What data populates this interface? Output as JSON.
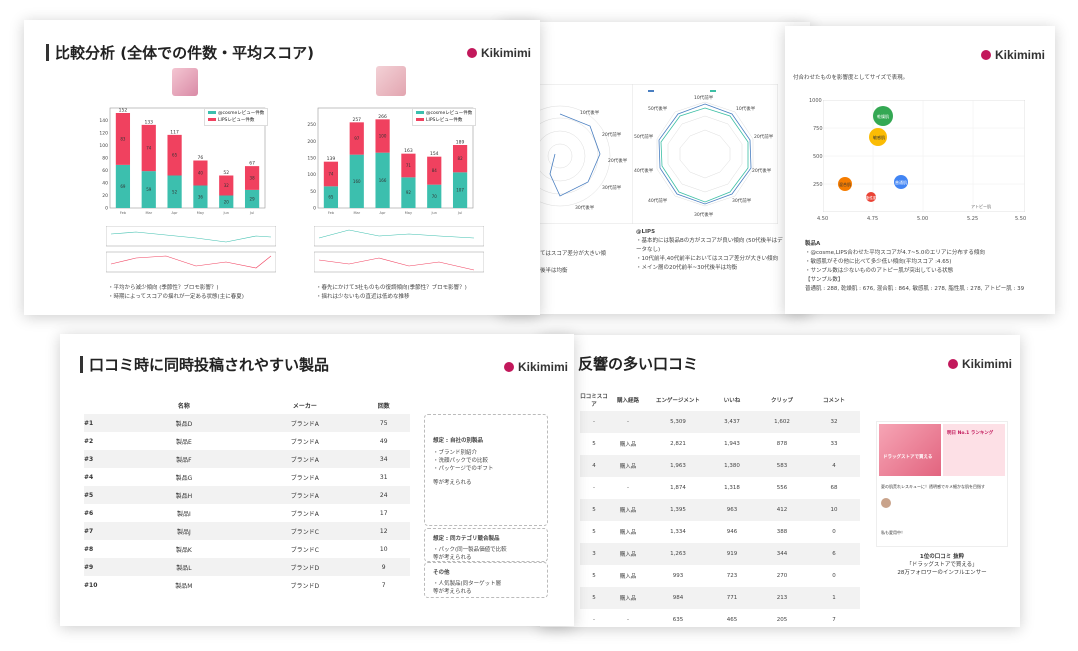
{
  "brand": "Kikimimi",
  "slide1": {
    "title": "比較分析 (全体での件数・平均スコア)",
    "legend": [
      "@cosmeレビュー件数",
      "LIPSレビュー件数"
    ],
    "left_notes": [
      "・平均から減少傾向 (季節性？ブロモ影響？)",
      "・時期によってスコアの揺れが一定ある状態(主に春夏)"
    ],
    "right_notes": [
      "・春先にかけて3社ものもの復調傾向(季節性？ブロモ影響？)",
      "・揺れは少ないもの直近は低めな推移"
    ]
  },
  "slide2": {
    "labels": [
      "10代前半",
      "10代後半",
      "20代前半",
      "20代後半",
      "30代前半",
      "30代後半",
      "40代前半",
      "40代後半",
      "50代前半",
      "50代後半"
    ],
    "left_notes": [
      "てはスコア差分が大きい傾",
      "後半は均衡"
    ],
    "right_head": "@LIPS",
    "right_notes": [
      "・基本的には製品Bの方がスコアが良い傾向 (50代後半はデータなし)",
      "・10代前半,40代前半においてはスコア差分が大きい傾向",
      "・メイン層の20代前半~30代後半は均衡"
    ]
  },
  "slide3": {
    "subtitle": "付合わせたものを影響度としてサイズで表現。",
    "yticks": [
      "1000",
      "750",
      "500",
      "250"
    ],
    "xticks": [
      "4.50",
      "4.75",
      "5.00",
      "5.25",
      "5.50"
    ],
    "bubbles": [
      "乾燥肌",
      "敏感肌",
      "混合肌",
      "普通肌",
      "脂性肌"
    ],
    "xaxis_label": "アトピー肌",
    "head": "製品A",
    "notes": [
      "・@cosme,LIPS合わせた平均スコアが4.7~5.0のエリアに分布する傾向",
      "・敏感肌がその他に比べて多少低い傾向(平均スコア :4.65)",
      "・サンプル数は少ないもののアトピー肌が突出している状態",
      "【サンプル数】",
      "普通肌 : 288, 乾燥肌 : 676, 混合肌 : 864, 敏感肌 : 278, 脂性肌 : 278, アトピー肌 : 39"
    ]
  },
  "slide4": {
    "title": "口コミ時に同時投稿されやすい製品",
    "headers": [
      "名称",
      "メーカー",
      "回数"
    ],
    "rows": [
      [
        "#1",
        "製品D",
        "ブランドA",
        "75"
      ],
      [
        "#2",
        "製品E",
        "ブランドA",
        "49"
      ],
      [
        "#3",
        "製品F",
        "ブランドA",
        "34"
      ],
      [
        "#4",
        "製品G",
        "ブランドA",
        "31"
      ],
      [
        "#5",
        "製品H",
        "ブランドA",
        "24"
      ],
      [
        "#6",
        "製品I",
        "ブランドA",
        "17"
      ],
      [
        "#7",
        "製品J",
        "ブランドC",
        "12"
      ],
      [
        "#8",
        "製品K",
        "ブランドC",
        "10"
      ],
      [
        "#9",
        "製品L",
        "ブランドD",
        "9"
      ],
      [
        "#10",
        "製品M",
        "ブランドD",
        "7"
      ]
    ],
    "box1_head": "想定 : 自社の別製品",
    "box1_items": [
      "・ブランド別紹介",
      "・洗顔パックでの比較",
      "・パッケージでのギフト"
    ],
    "box1_foot": "等が考えられる",
    "box2_head": "想定 : 同カテゴリ競合製品",
    "box2_items": [
      "・パック(同一製品価値で比較"
    ],
    "box2_foot": "等が考えられる",
    "box3_head": "その他",
    "box3_items": [
      "・人気製品(同ターゲット層"
    ],
    "box3_foot": "等が考えられる"
  },
  "slide5": {
    "title": "反響の多い口コミ",
    "headers": [
      "口コミスコア",
      "購入経路",
      "エンゲージメント",
      "いいね",
      "クリップ",
      "コメント"
    ],
    "rows": [
      [
        "-",
        "-",
        "5,309",
        "3,437",
        "1,602",
        "32"
      ],
      [
        "5",
        "購入品",
        "2,821",
        "1,943",
        "878",
        "33"
      ],
      [
        "4",
        "購入品",
        "1,963",
        "1,380",
        "583",
        "4"
      ],
      [
        "-",
        "-",
        "1,874",
        "1,318",
        "556",
        "68"
      ],
      [
        "5",
        "購入品",
        "1,395",
        "963",
        "412",
        "10"
      ],
      [
        "5",
        "購入品",
        "1,334",
        "946",
        "388",
        "0"
      ],
      [
        "3",
        "購入品",
        "1,263",
        "919",
        "344",
        "6"
      ],
      [
        "5",
        "購入品",
        "993",
        "723",
        "270",
        "0"
      ],
      [
        "5",
        "購入品",
        "984",
        "771",
        "213",
        "1"
      ],
      [
        "-",
        "-",
        "635",
        "465",
        "205",
        "7"
      ]
    ],
    "card_header1": "ドラッグストアで買える",
    "card_header2": "明日 No.1 ランキング",
    "card_body": "夏の肌荒れレスキューに！透明感でキメ細かな肌を目指す",
    "card_tail": "私も愛用中！",
    "caption1": "1位の口コミ 抜粋",
    "caption2": "「ドラッグストアで買える」",
    "caption3": "28万フォロワーのインフルエンサー"
  },
  "chart_data": [
    {
      "type": "bar",
      "stacked": true,
      "categories": [
        "Feb",
        "Mar",
        "Apr",
        "May",
        "Jun",
        "Jul"
      ],
      "series": [
        {
          "name": "@cosmeレビュー件数",
          "values": [
            69,
            59,
            52,
            36,
            20,
            29
          ]
        },
        {
          "name": "LIPSレビュー件数",
          "values": [
            83,
            74,
            65,
            40,
            32,
            38
          ]
        }
      ],
      "totals": [
        152,
        133,
        117,
        76,
        52,
        67
      ],
      "ylim": [
        0,
        160
      ]
    },
    {
      "type": "bar",
      "stacked": true,
      "categories": [
        "Feb",
        "Mar",
        "Apr",
        "May",
        "Jun",
        "Jul"
      ],
      "series": [
        {
          "name": "@cosmeレビュー件数",
          "values": [
            65,
            160,
            166,
            92,
            70,
            107
          ]
        },
        {
          "name": "LIPSレビュー件数",
          "values": [
            74,
            97,
            100,
            71,
            84,
            82
          ]
        }
      ],
      "totals": [
        139,
        257,
        266,
        163,
        154,
        189
      ],
      "ylim": [
        0,
        300
      ]
    }
  ]
}
